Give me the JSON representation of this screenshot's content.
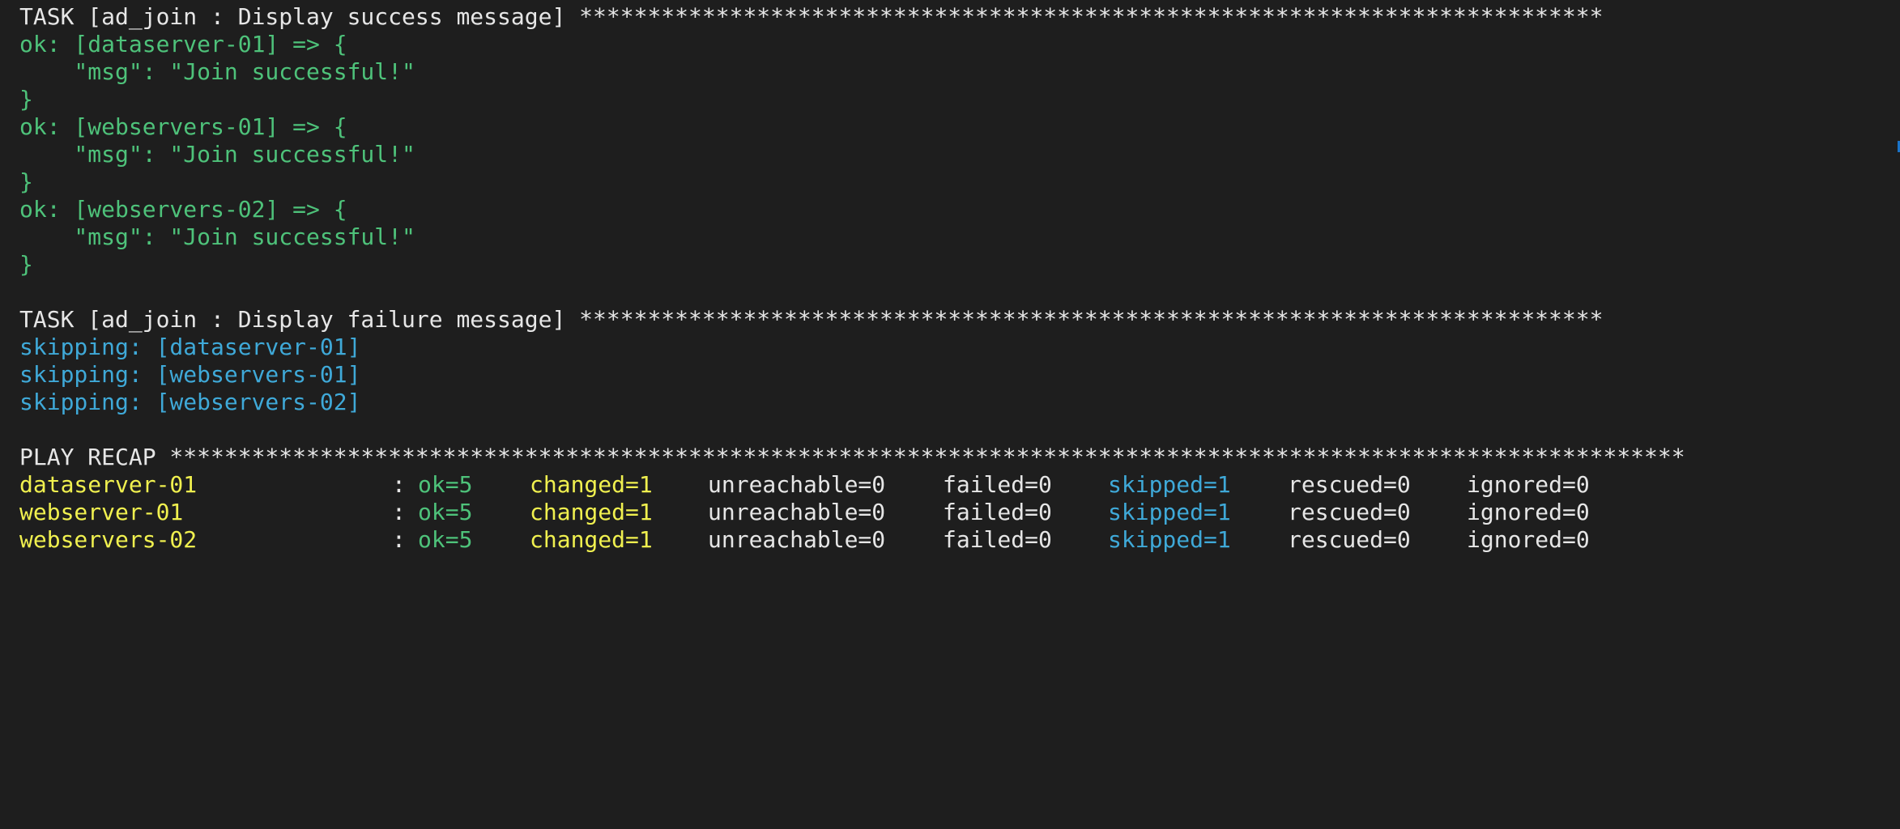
{
  "lines": {
    "task1_header": "TASK [ad_join : Display success message] ***************************************************************************",
    "ok1_open": "ok: [dataserver-01] => {",
    "ok1_msg": "    \"msg\": \"Join successful!\"",
    "ok1_close": "}",
    "ok2_open": "ok: [webservers-01] => {",
    "ok2_msg": "    \"msg\": \"Join successful!\"",
    "ok2_close": "}",
    "ok3_open": "ok: [webservers-02] => {",
    "ok3_msg": "    \"msg\": \"Join successful!\"",
    "ok3_close": "}",
    "task2_header": "TASK [ad_join : Display failure message] ***************************************************************************",
    "skip1": "skipping: [dataserver-01]",
    "skip2": "skipping: [webservers-01]",
    "skip3": "skipping: [webservers-02]",
    "recap_header": "PLAY RECAP ***************************************************************************************************************"
  },
  "recap": [
    {
      "host": "dataserver-01",
      "colon": ":",
      "ok": "ok=5",
      "changed": "changed=1",
      "unreachable": "unreachable=0",
      "failed": "failed=0",
      "skipped": "skipped=1",
      "rescued": "rescued=0",
      "ignored": "ignored=0"
    },
    {
      "host": "webserver-01",
      "colon": ":",
      "ok": "ok=5",
      "changed": "changed=1",
      "unreachable": "unreachable=0",
      "failed": "failed=0",
      "skipped": "skipped=1",
      "rescued": "rescued=0",
      "ignored": "ignored=0"
    },
    {
      "host": "webservers-02",
      "colon": ":",
      "ok": "ok=5",
      "changed": "changed=1",
      "unreachable": "unreachable=0",
      "failed": "failed=0",
      "skipped": "skipped=1",
      "rescued": "rescued=0",
      "ignored": "ignored=0"
    }
  ],
  "colors": {
    "background": "#1e1e1e",
    "text": "#e6e6e6",
    "ok": "#4ec27a",
    "changed": "#f0f04f",
    "skipped": "#3fa9d8"
  }
}
